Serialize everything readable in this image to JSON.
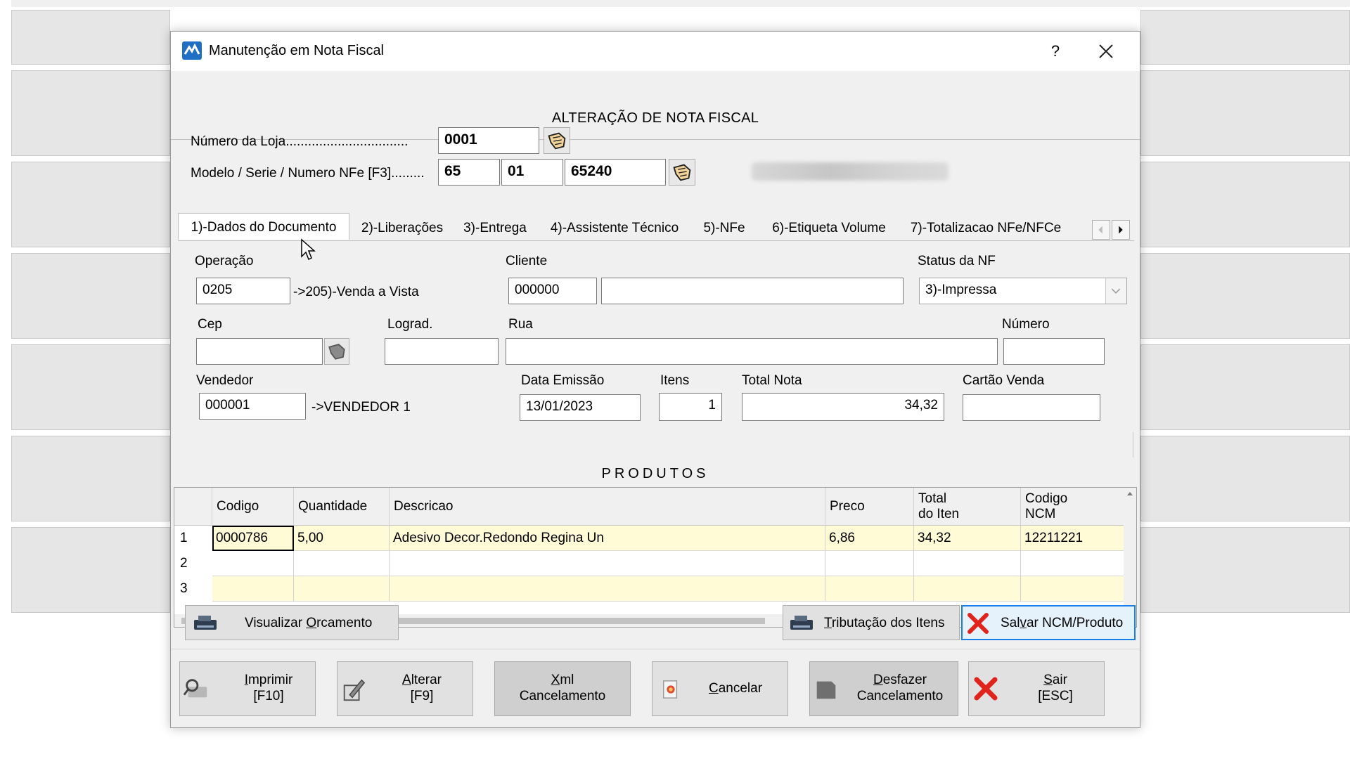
{
  "window": {
    "title": "Manutenção em Nota Fiscal",
    "help": "?",
    "header": "ALTERAÇÃO DE NOTA FISCAL"
  },
  "loja": {
    "label": "Número da Loja.................................",
    "value": "0001"
  },
  "nfe": {
    "label": "Modelo / Serie / Numero NFe [F3].........",
    "modelo": "65",
    "serie": "01",
    "numero": "65240"
  },
  "tabs": [
    {
      "label": "1)-Dados do Documento"
    },
    {
      "label": "2)-Liberações"
    },
    {
      "label": "3)-Entrega"
    },
    {
      "label": "4)-Assistente Técnico"
    },
    {
      "label": "5)-NFe"
    },
    {
      "label": "6)-Etiqueta Volume"
    },
    {
      "label": "7)-Totalizacao NFe/NFCe"
    }
  ],
  "form": {
    "operacao_label": "Operação",
    "operacao_value": "0205",
    "operacao_desc": "->205)-Venda a Vista",
    "cliente_label": "Cliente",
    "cliente_value": "000000",
    "cliente_nome": "",
    "status_label": "Status da NF",
    "status_value": "3)-Impressa",
    "cep_label": "Cep",
    "cep_value": "",
    "lograd_label": "Lograd.",
    "lograd_value": "",
    "rua_label": "Rua",
    "rua_value": "",
    "numero_label": "Número",
    "numero_value": "",
    "vendedor_label": "Vendedor",
    "vendedor_value": "000001",
    "vendedor_desc": "->VENDEDOR 1",
    "data_label": "Data Emissão",
    "data_value": "13/01/2023",
    "itens_label": "Itens",
    "itens_value": "1",
    "total_label": "Total Nota",
    "total_value": "34,32",
    "cartao_label": "Cartão Venda",
    "cartao_value": ""
  },
  "produtos": {
    "title": "PRODUTOS",
    "columns": {
      "codigo": "Codigo",
      "quantidade": "Quantidade",
      "descricao": "Descricao",
      "preco": "Preco",
      "total_1": "Total",
      "total_2": "do Iten",
      "ncm_1": "Codigo",
      "ncm_2": "NCM"
    },
    "rows": [
      {
        "n": "1",
        "codigo": "0000786",
        "quantidade": "5,00",
        "descricao": "Adesivo Decor.Redondo Regina  Un",
        "preco": "6,86",
        "total": "34,32",
        "ncm": "12211221"
      },
      {
        "n": "2",
        "codigo": "",
        "quantidade": "",
        "descricao": "",
        "preco": "",
        "total": "",
        "ncm": ""
      },
      {
        "n": "3",
        "codigo": "",
        "quantidade": "",
        "descricao": "",
        "preco": "",
        "total": "",
        "ncm": ""
      }
    ]
  },
  "actions": {
    "visualizar_pre": "Visualizar ",
    "visualizar_u": "O",
    "visualizar_post": "rcamento",
    "tributacao_u": "T",
    "tributacao_post": "ributação dos Itens",
    "salvar_pre": "Sal",
    "salvar_u": "v",
    "salvar_post": "ar NCM/Produto"
  },
  "footer": {
    "imprimir_u": "I",
    "imprimir_1": "mprimir",
    "imprimir_2": "[F10]",
    "alterar_u": "A",
    "alterar_1": "lterar",
    "alterar_2": "[F9]",
    "xml_u": "X",
    "xml_1": "ml",
    "xml_2": "Cancelamento",
    "cancelar_u": "C",
    "cancelar_1": "ancelar",
    "desfazer_u": "D",
    "desfazer_1": "esfazer",
    "desfazer_2": "Cancelamento",
    "sair_u": "S",
    "sair_1": "air",
    "sair_2": "[ESC]"
  }
}
